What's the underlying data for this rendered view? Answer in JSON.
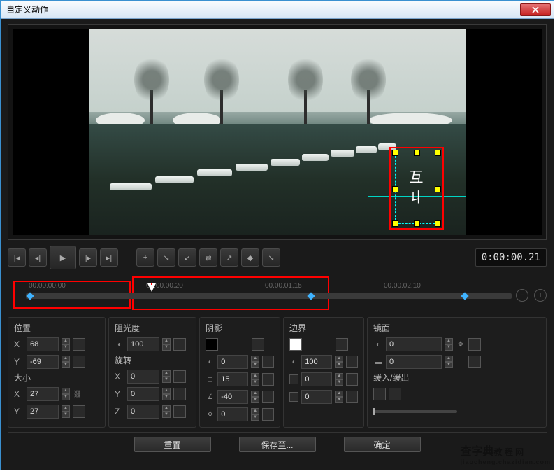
{
  "window": {
    "title": "自定义动作"
  },
  "timecode": "0:00:00.21",
  "timeline": {
    "ticks": [
      "00.00.00.00",
      "00.00.00.20",
      "00.00.01.15",
      "00.00.02.10"
    ]
  },
  "panels": {
    "position": {
      "label": "位置",
      "x_label": "X",
      "x_value": "68",
      "y_label": "Y",
      "y_value": "-69"
    },
    "size": {
      "label": "大小",
      "x_label": "X",
      "x_value": "27",
      "y_label": "Y",
      "y_value": "27"
    },
    "opacity": {
      "label": "阻光度",
      "value": "100"
    },
    "rotation": {
      "label": "旋转",
      "x_label": "X",
      "x_value": "0",
      "y_label": "Y",
      "y_value": "0",
      "z_label": "Z",
      "z_value": "0"
    },
    "shadow": {
      "label": "阴影",
      "v1": "0",
      "v2": "15",
      "v3": "-40",
      "v4": "0"
    },
    "border": {
      "label": "边界",
      "v1": "100",
      "v2": "0",
      "v3": "0"
    },
    "mirror": {
      "label": "镜面",
      "v1": "0",
      "v2": "0"
    },
    "easing": {
      "label": "缓入/缓出"
    }
  },
  "footer": {
    "reset": "重置",
    "saveas": "保存至...",
    "ok": "确定"
  },
  "watermark": {
    "main": "查字典",
    "sub": "jiaocheng.chazidian.com",
    "tag": "教 程 网"
  }
}
